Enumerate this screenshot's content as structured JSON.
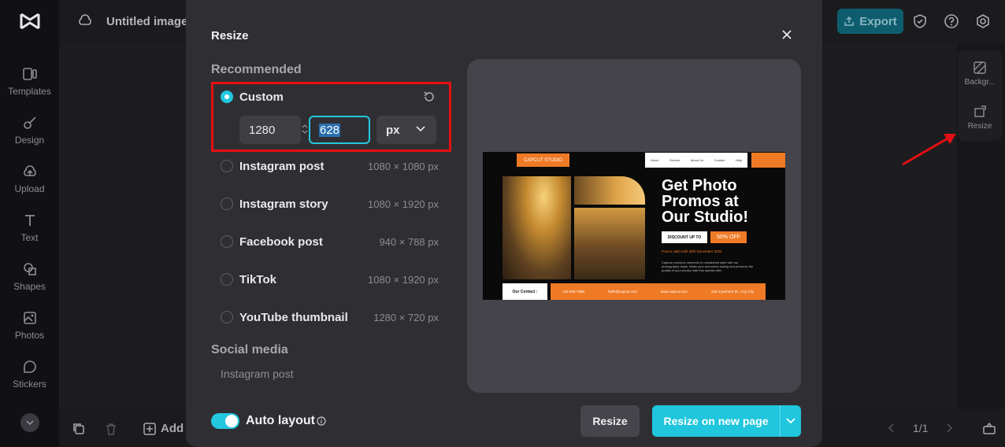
{
  "topbar": {
    "document_title": "Untitled image",
    "export_label": "Export"
  },
  "rail": {
    "items": [
      {
        "label": "Templates",
        "icon": "templates-icon"
      },
      {
        "label": "Design",
        "icon": "design-icon"
      },
      {
        "label": "Upload",
        "icon": "upload-icon"
      },
      {
        "label": "Text",
        "icon": "text-icon"
      },
      {
        "label": "Shapes",
        "icon": "shapes-icon"
      },
      {
        "label": "Photos",
        "icon": "photos-icon"
      },
      {
        "label": "Stickers",
        "icon": "stickers-icon"
      }
    ]
  },
  "right_panel": {
    "background_label": "Backgr...",
    "resize_label": "Resize"
  },
  "bottombar": {
    "add_label": "Add",
    "pager": "1/1"
  },
  "modal": {
    "title": "Resize",
    "recommended_label": "Recommended",
    "custom": {
      "label": "Custom",
      "width": "1280",
      "height": "628",
      "unit": "px"
    },
    "options": [
      {
        "label": "Instagram post",
        "size": "1080 × 1080 px"
      },
      {
        "label": "Instagram story",
        "size": "1080 × 1920 px"
      },
      {
        "label": "Facebook post",
        "size": "940 × 788 px"
      },
      {
        "label": "TikTok",
        "size": "1080 × 1920 px"
      },
      {
        "label": "YouTube thumbnail",
        "size": "1280 × 720 px"
      }
    ],
    "social_media_label": "Social media",
    "social_first": "Instagram post",
    "auto_layout_label": "Auto layout",
    "auto_layout_on": true,
    "resize_button": "Resize",
    "resize_new_page_button": "Resize on new page",
    "accent_color": "#1fc6dd"
  },
  "poster": {
    "tag": "CAPCUT STUDIO",
    "nav": [
      "Home",
      "Service",
      "About Us",
      "Contact",
      "Help"
    ],
    "headline": "Get Photo Promos at Our Studio!",
    "discount_button": "DISCOUNT UP TO",
    "discount_value": "50% OFF",
    "valid_text": "Promo valid until 30th December 2023",
    "body_text": "Capture precious moments in unmatched style with our photography deals. Make your memories lasting and preserve the quality of your photos with this special offer.",
    "contact_label": "Our Contact :",
    "contact_items": [
      "123-456-7890",
      "hello@capcut.com",
      "www.capcut.com",
      "123 Anywhere St., Any City"
    ]
  }
}
